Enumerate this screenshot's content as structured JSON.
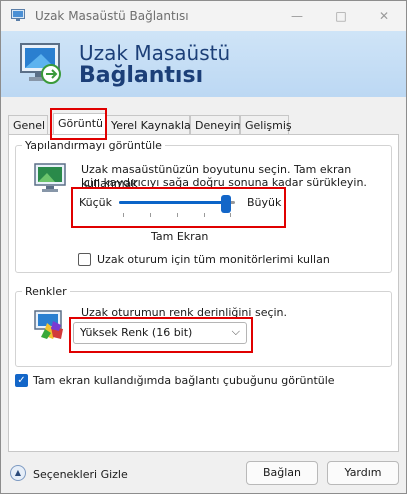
{
  "window": {
    "title": "Uzak Masaüstü Bağlantısı"
  },
  "banner": {
    "line1": "Uzak Masaüstü",
    "line2": "Bağlantısı"
  },
  "tabs": [
    {
      "label": "Genel"
    },
    {
      "label": "Görüntü",
      "active": true
    },
    {
      "label": "Yerel Kaynaklar"
    },
    {
      "label": "Deneyim"
    },
    {
      "label": "Gelişmiş"
    }
  ],
  "display_config": {
    "group_title": "Yapılandırmayı görüntüle",
    "description_line1": "Uzak masaüstünüzün boyutunu seçin. Tam ekran kullanmak",
    "description_line2": "için kaydırıcıyı sağa doğru sonuna kadar sürükleyin.",
    "slider_min_label": "Küçük",
    "slider_max_label": "Büyük",
    "slider_value_label": "Tam Ekran",
    "slider_position": 1.0,
    "all_monitors_label": "Uzak oturum için tüm monitörlerimi kullan",
    "all_monitors_checked": false
  },
  "colors": {
    "group_title": "Renkler",
    "description": "Uzak oturumun renk derinliğini seçin.",
    "depth_selected": "Yüksek Renk (16 bit)"
  },
  "connection_bar": {
    "label": "Tam ekran kullandığımda bağlantı çubuğunu görüntüle",
    "checked": true
  },
  "footer": {
    "toggle_label": "Seçenekleri Gizle",
    "connect_label": "Bağlan",
    "help_label": "Yardım"
  },
  "theme": {
    "accent": "#1366c8",
    "highlight": "#e00000"
  }
}
